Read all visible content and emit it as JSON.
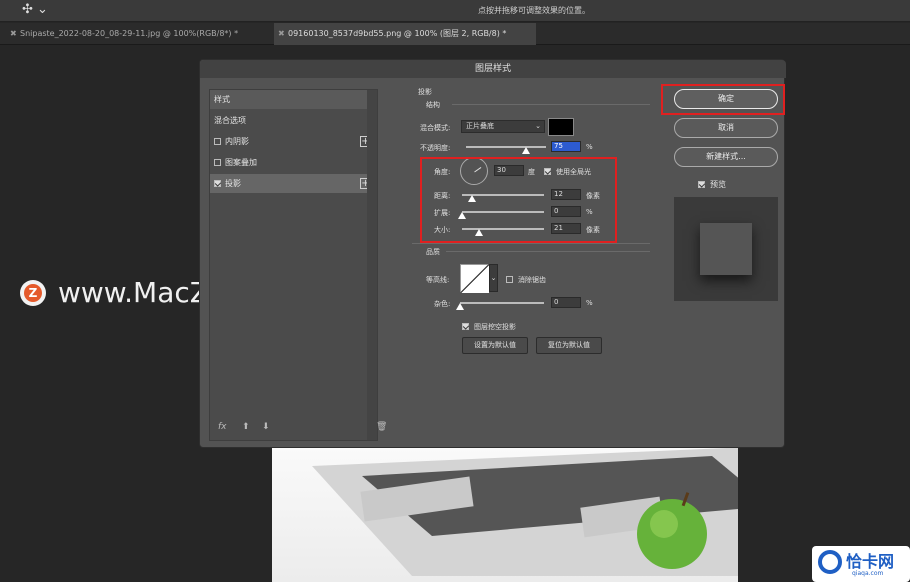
{
  "topbar": {
    "move_icon": "✣ ⌄",
    "hint": "点按并拖移可调整效果的位置。"
  },
  "tabs": [
    {
      "label": "Snipaste_2022-08-20_08-29-11.jpg @ 100%(RGB/8*) *"
    },
    {
      "label": "09160130_8537d9bd55.png @ 100% (图层 2, RGB/8) *"
    }
  ],
  "watermark": {
    "logo_letter": "Z",
    "text": "www.MacZ.com"
  },
  "corner_logo": {
    "text": "恰卡网",
    "sub": "qiaqa.com"
  },
  "dialog": {
    "title": "图层样式",
    "left": {
      "header": "样式",
      "items": [
        {
          "label": "混合选项",
          "checkbox": false,
          "plus": false
        },
        {
          "label": "内阴影",
          "checkbox": true,
          "checked": false,
          "plus": true
        },
        {
          "label": "图案叠加",
          "checkbox": true,
          "checked": false,
          "plus": false
        },
        {
          "label": "投影",
          "checkbox": true,
          "checked": true,
          "plus": true
        }
      ],
      "footer": {
        "fx": "fx",
        "up": "⬆",
        "down": "⬇",
        "trash": "🗑"
      }
    },
    "drop_shadow": {
      "title": "投影",
      "structure": "结构",
      "blend_mode_label": "混合模式:",
      "blend_mode_value": "正片叠底",
      "opacity_label": "不透明度:",
      "opacity_value": "75",
      "opacity_unit": "%",
      "angle_label": "角度:",
      "angle_value": "30",
      "angle_unit": "度",
      "global_light_label": "使用全局光",
      "distance_label": "距离:",
      "distance_value": "12",
      "distance_unit": "像素",
      "spread_label": "扩展:",
      "spread_value": "0",
      "spread_unit": "%",
      "size_label": "大小:",
      "size_value": "21",
      "size_unit": "像素",
      "quality": "品质",
      "contour_label": "等高线:",
      "anti_alias_label": "消除锯齿",
      "noise_label": "杂色:",
      "noise_value": "0",
      "noise_unit": "%",
      "knockout_label": "图层挖空投影",
      "set_default": "设置为默认值",
      "reset_default": "复位为默认值",
      "slider_levels": {
        "opacity": 0.75,
        "distance": 0.12,
        "spread": 0.0,
        "size": 0.21,
        "noise": 0.0
      }
    },
    "buttons": {
      "ok": "确定",
      "cancel": "取消",
      "new_style": "新建样式...",
      "preview": "预览"
    }
  },
  "colors": {
    "highlight_red": "#e02020",
    "shadow_color": "#000000",
    "selection_blue": "#2d5bd0"
  }
}
